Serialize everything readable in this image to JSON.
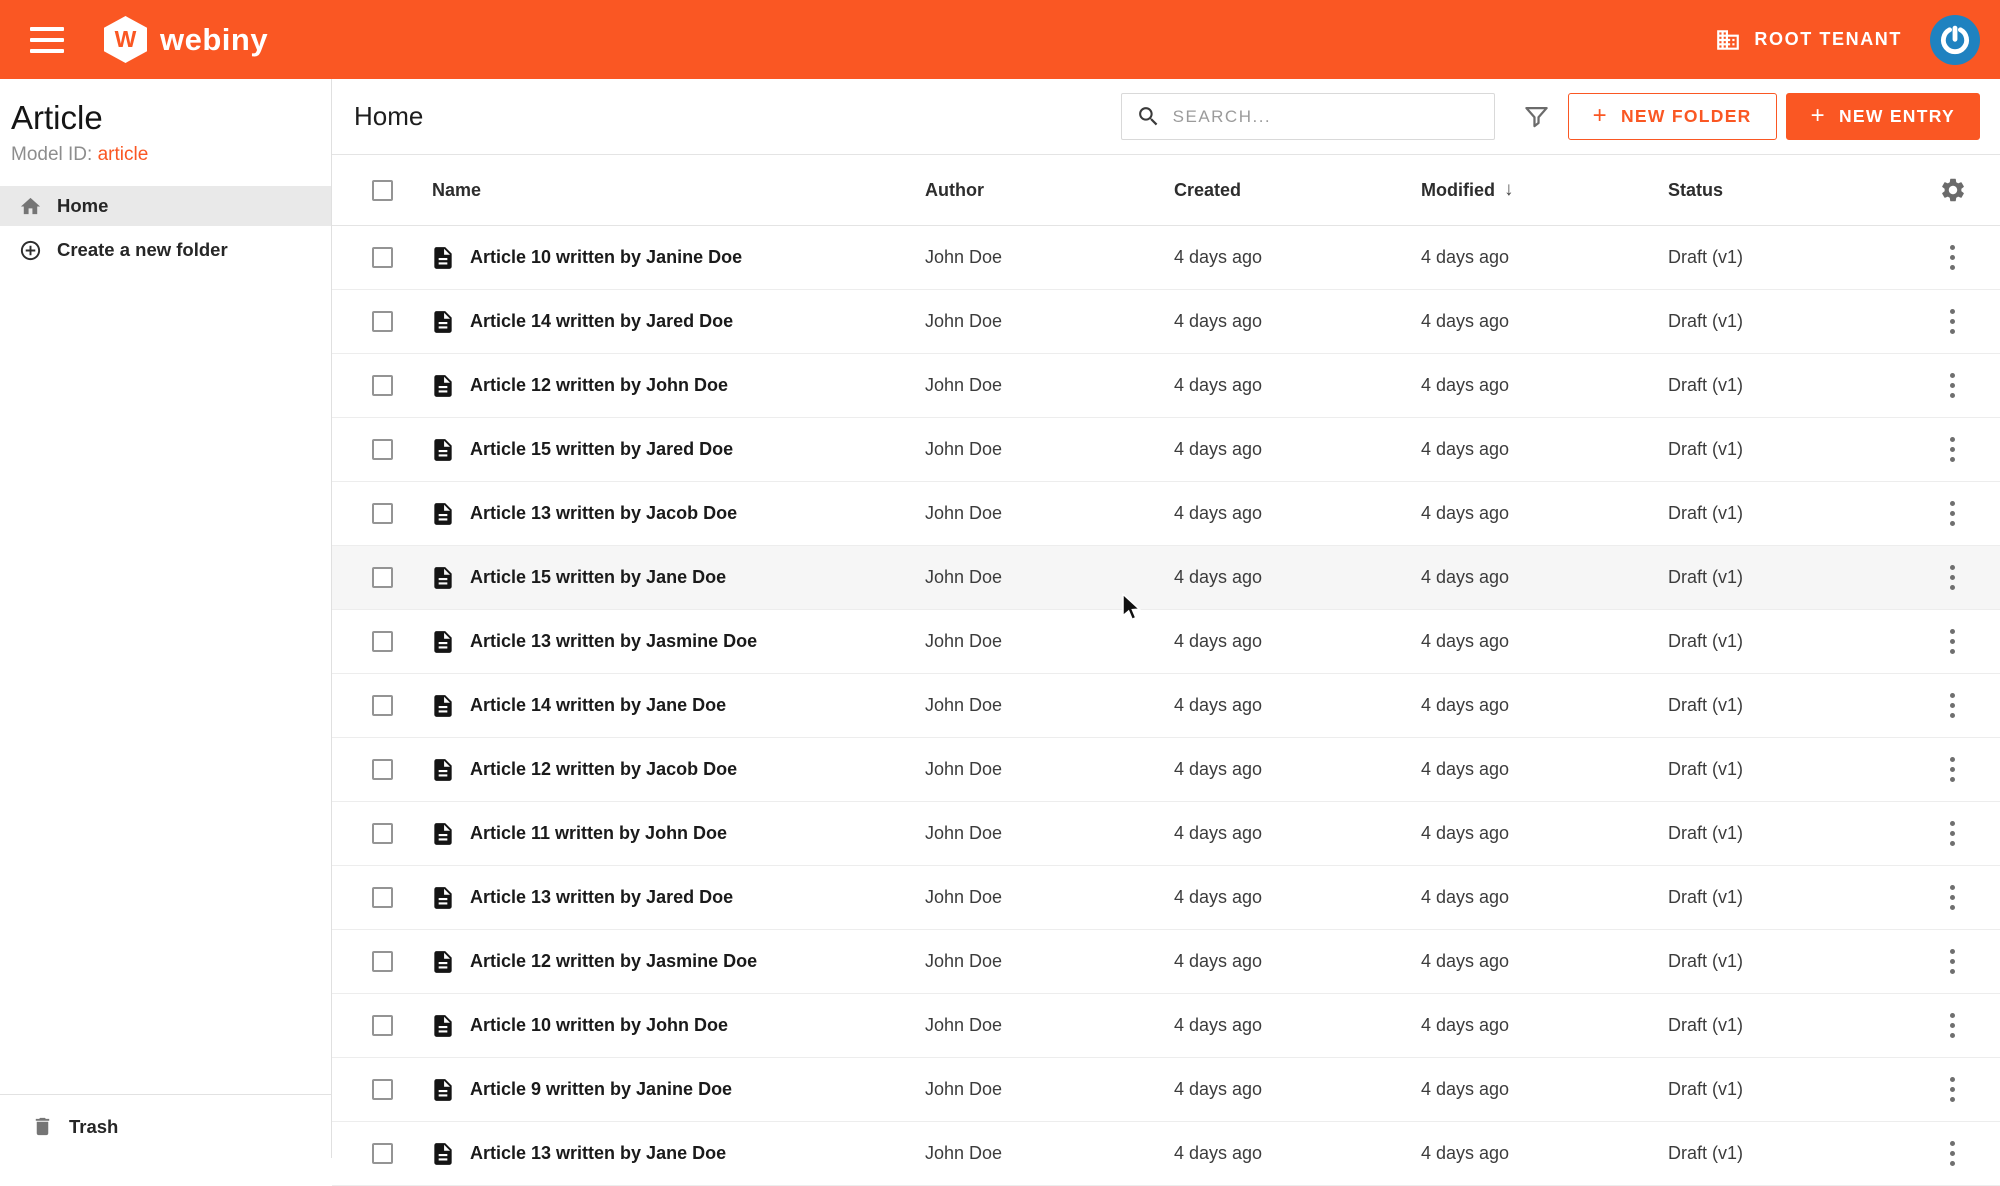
{
  "topbar": {
    "brand": "webiny",
    "tenant_label": "ROOT TENANT"
  },
  "sidebar": {
    "title": "Article",
    "model_id_label": "Model ID:",
    "model_id_value": "article",
    "items": [
      {
        "label": "Home"
      },
      {
        "label": "Create a new folder"
      }
    ],
    "trash_label": "Trash"
  },
  "toolbar": {
    "title": "Home",
    "search_placeholder": "SEARCH...",
    "new_folder_label": "NEW FOLDER",
    "new_entry_label": "NEW ENTRY"
  },
  "icons": {
    "plus": "+",
    "sort_desc": "↓"
  },
  "colors": {
    "primary": "#fa5723",
    "avatar_blue": "#1f82c0"
  },
  "table": {
    "columns": [
      "Name",
      "Author",
      "Created",
      "Modified",
      "Status"
    ],
    "sorted_column": "Modified",
    "sort_direction": "desc",
    "hover_row_index": 5,
    "rows": [
      {
        "name": "Article 10 written by Janine Doe",
        "author": "John Doe",
        "created": "4 days ago",
        "modified": "4 days ago",
        "status": "Draft (v1)"
      },
      {
        "name": "Article 14 written by Jared Doe",
        "author": "John Doe",
        "created": "4 days ago",
        "modified": "4 days ago",
        "status": "Draft (v1)"
      },
      {
        "name": "Article 12 written by John Doe",
        "author": "John Doe",
        "created": "4 days ago",
        "modified": "4 days ago",
        "status": "Draft (v1)"
      },
      {
        "name": "Article 15 written by Jared Doe",
        "author": "John Doe",
        "created": "4 days ago",
        "modified": "4 days ago",
        "status": "Draft (v1)"
      },
      {
        "name": "Article 13 written by Jacob Doe",
        "author": "John Doe",
        "created": "4 days ago",
        "modified": "4 days ago",
        "status": "Draft (v1)"
      },
      {
        "name": "Article 15 written by Jane Doe",
        "author": "John Doe",
        "created": "4 days ago",
        "modified": "4 days ago",
        "status": "Draft (v1)"
      },
      {
        "name": "Article 13 written by Jasmine Doe",
        "author": "John Doe",
        "created": "4 days ago",
        "modified": "4 days ago",
        "status": "Draft (v1)"
      },
      {
        "name": "Article 14 written by Jane Doe",
        "author": "John Doe",
        "created": "4 days ago",
        "modified": "4 days ago",
        "status": "Draft (v1)"
      },
      {
        "name": "Article 12 written by Jacob Doe",
        "author": "John Doe",
        "created": "4 days ago",
        "modified": "4 days ago",
        "status": "Draft (v1)"
      },
      {
        "name": "Article 11 written by John Doe",
        "author": "John Doe",
        "created": "4 days ago",
        "modified": "4 days ago",
        "status": "Draft (v1)"
      },
      {
        "name": "Article 13 written by Jared Doe",
        "author": "John Doe",
        "created": "4 days ago",
        "modified": "4 days ago",
        "status": "Draft (v1)"
      },
      {
        "name": "Article 12 written by Jasmine Doe",
        "author": "John Doe",
        "created": "4 days ago",
        "modified": "4 days ago",
        "status": "Draft (v1)"
      },
      {
        "name": "Article 10 written by John Doe",
        "author": "John Doe",
        "created": "4 days ago",
        "modified": "4 days ago",
        "status": "Draft (v1)"
      },
      {
        "name": "Article 9 written by Janine Doe",
        "author": "John Doe",
        "created": "4 days ago",
        "modified": "4 days ago",
        "status": "Draft (v1)"
      },
      {
        "name": "Article 13 written by Jane Doe",
        "author": "John Doe",
        "created": "4 days ago",
        "modified": "4 days ago",
        "status": "Draft (v1)"
      }
    ]
  }
}
